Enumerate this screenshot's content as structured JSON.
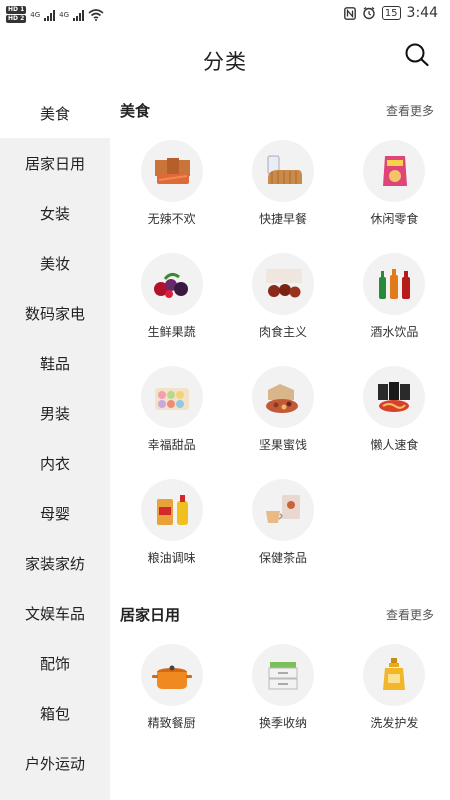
{
  "status_bar": {
    "hd1": "HD 1",
    "hd2": "HD 2",
    "net1": "4G",
    "net2": "4G",
    "battery": "15",
    "time": "3:44"
  },
  "header": {
    "title": "分类",
    "search_icon": "search-icon"
  },
  "sidebar": {
    "items": [
      {
        "label": "美食",
        "active": true
      },
      {
        "label": "居家日用"
      },
      {
        "label": "女装"
      },
      {
        "label": "美妆"
      },
      {
        "label": "数码家电"
      },
      {
        "label": "鞋品"
      },
      {
        "label": "男装"
      },
      {
        "label": "内衣"
      },
      {
        "label": "母婴"
      },
      {
        "label": "家装家纺"
      },
      {
        "label": "文娱车品"
      },
      {
        "label": "配饰"
      },
      {
        "label": "箱包"
      },
      {
        "label": "户外运动"
      }
    ]
  },
  "sections": [
    {
      "title": "美食",
      "more": "查看更多",
      "items": [
        {
          "label": "无辣不欢",
          "icon": "spicy-snack-icon"
        },
        {
          "label": "快捷早餐",
          "icon": "bread-icon"
        },
        {
          "label": "休闲零食",
          "icon": "chips-bag-icon"
        },
        {
          "label": "生鲜果蔬",
          "icon": "fruit-icon"
        },
        {
          "label": "肉食主义",
          "icon": "meat-icon"
        },
        {
          "label": "酒水饮品",
          "icon": "bottles-icon"
        },
        {
          "label": "幸福甜品",
          "icon": "macaron-icon"
        },
        {
          "label": "坚果蜜饯",
          "icon": "nuts-icon"
        },
        {
          "label": "懒人速食",
          "icon": "noodles-icon"
        },
        {
          "label": "粮油调味",
          "icon": "rice-oil-icon"
        },
        {
          "label": "保健茶品",
          "icon": "tea-icon"
        }
      ]
    },
    {
      "title": "居家日用",
      "more": "查看更多",
      "items": [
        {
          "label": "精致餐厨",
          "icon": "pot-icon"
        },
        {
          "label": "换季收纳",
          "icon": "storage-box-icon"
        },
        {
          "label": "洗发护发",
          "icon": "shampoo-icon"
        }
      ]
    }
  ],
  "colors": {
    "sidebar_bg": "#f1f1f1",
    "active_bg": "#ffffff",
    "circle_bg": "#f2f2f2"
  }
}
